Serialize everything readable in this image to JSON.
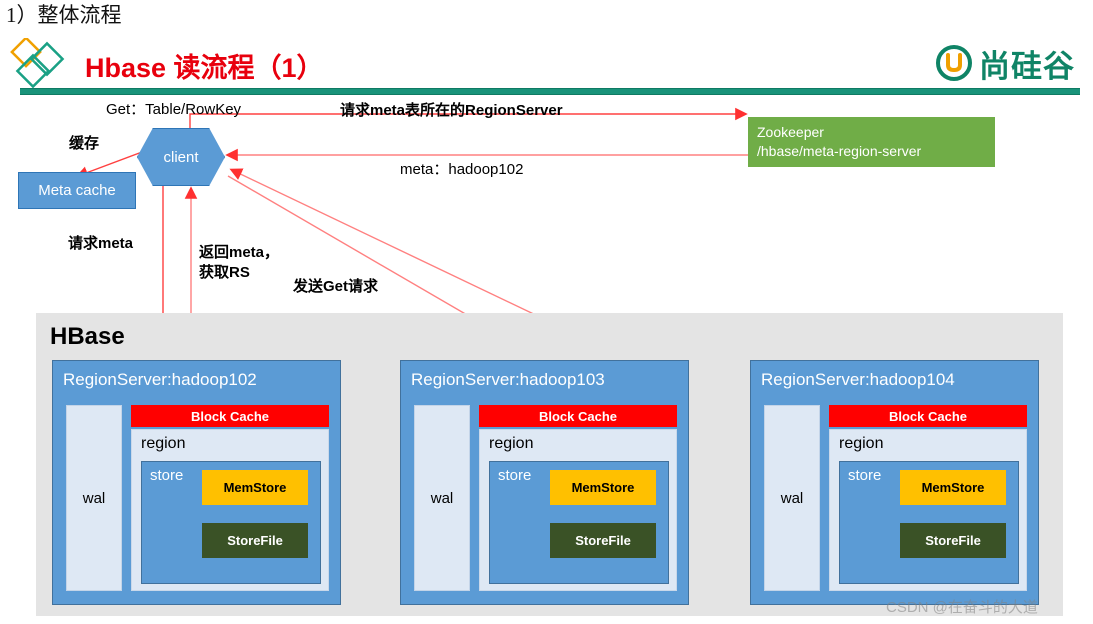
{
  "note": {
    "heading": "1）整体流程"
  },
  "header": {
    "title": "Hbase 读流程（1）",
    "title_color": "#e8000d",
    "rule_color": "#19937a",
    "logo_mark": "diamonds-logo-icon",
    "brand": {
      "mark": "u-circle-icon",
      "text": "尚硅谷",
      "color": "#0f8466"
    }
  },
  "diagram": {
    "labels": {
      "get_request": "Get：Table/RowKey",
      "cache": "缓存",
      "request_meta_region_server": "请求meta表所在的RegionServer",
      "meta_hadoop102": "meta：hadoop102",
      "request_meta": "请求meta",
      "return_meta_line1": "返回meta，",
      "return_meta_line2": "获取RS",
      "send_get_request": "发送Get请求"
    },
    "client": {
      "label": "client",
      "fill": "#5b9bd5"
    },
    "meta_cache": {
      "label": "Meta cache",
      "fill": "#5b9bd5"
    },
    "zookeeper": {
      "line1": "Zookeeper",
      "line2": "/hbase/meta-region-server",
      "fill": "#70ad47"
    },
    "hbase": {
      "title": "HBase",
      "fill": "#e4e4e4"
    },
    "region_servers": [
      {
        "title": "RegionServer:hadoop102",
        "wal": "wal",
        "block_cache": "Block Cache",
        "region": "region",
        "store": "store",
        "memstore": "MemStore",
        "storefile": "StoreFile"
      },
      {
        "title": "RegionServer:hadoop103",
        "wal": "wal",
        "block_cache": "Block Cache",
        "region": "region",
        "store": "store",
        "memstore": "MemStore",
        "storefile": "StoreFile"
      },
      {
        "title": "RegionServer:hadoop104",
        "wal": "wal",
        "block_cache": "Block Cache",
        "region": "region",
        "store": "store",
        "memstore": "MemStore",
        "storefile": "StoreFile"
      }
    ],
    "colors": {
      "block_cache": "#ff0000",
      "memstore": "#ffc000",
      "storefile": "#3a5226",
      "region_server": "#5b9bd5",
      "wal": "#dee8f4",
      "arrow_red": "#ff4040",
      "arrow_black": "#000000"
    }
  },
  "watermark": {
    "text": "CSDN @在奋斗的大道"
  }
}
